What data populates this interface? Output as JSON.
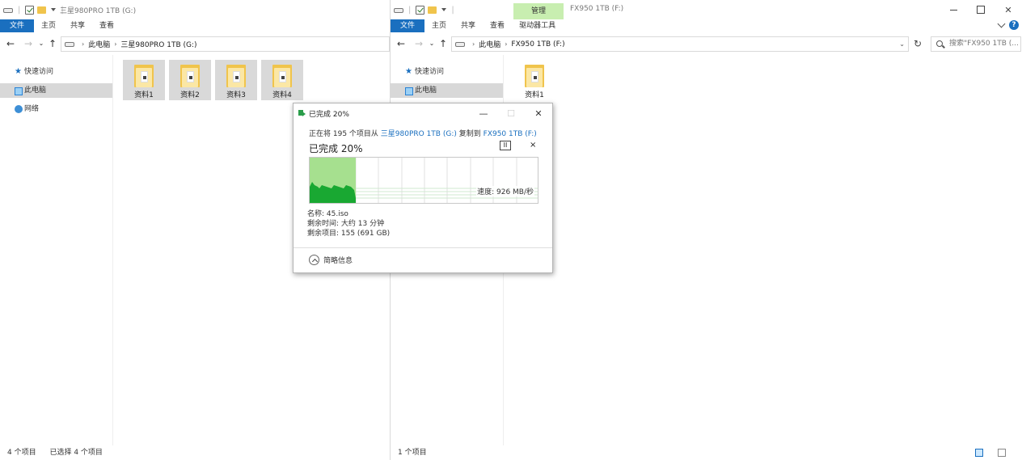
{
  "left_window": {
    "title": "三星980PRO 1TB (G:)",
    "ribbon_tabs": [
      "文件",
      "主页",
      "共享",
      "查看"
    ],
    "address": {
      "segments": [
        "此电脑",
        "三星980PRO 1TB (G:)"
      ]
    },
    "nav": [
      "快速访问",
      "此电脑",
      "网络"
    ],
    "folders": [
      "资料1",
      "资料2",
      "资料3",
      "资料4"
    ],
    "status": {
      "count": "4 个项目",
      "selected": "已选择 4 个项目"
    }
  },
  "right_window": {
    "title": "FX950 1TB (F:)",
    "manage_tab": "管理",
    "ribbon_tabs": [
      "文件",
      "主页",
      "共享",
      "查看",
      "驱动器工具"
    ],
    "address": {
      "segments": [
        "此电脑",
        "FX950 1TB (F:)"
      ]
    },
    "search_placeholder": "搜索\"FX950 1TB (...",
    "nav": [
      "快速访问",
      "此电脑"
    ],
    "folders": [
      "资料1"
    ],
    "status": {
      "count": "1 个项目"
    }
  },
  "copy_dialog": {
    "title": "已完成 20%",
    "line_prefix": "正在将 195 个项目从",
    "source": "三星980PRO 1TB (G:)",
    "line_mid": "复制到",
    "dest": "FX950 1TB (F:)",
    "percent_text": "已完成 20%",
    "progress_fraction": 0.2,
    "speed": "速度: 926 MB/秒",
    "name_label": "名称: 45.iso",
    "time_left": "剩余时间: 大约 13 分钟",
    "items_left": "剩余项目: 155 (691 GB)",
    "less_info": "简略信息",
    "pause_symbol": "II",
    "cancel_symbol": "×"
  },
  "colors": {
    "file_tab": "#1a6fbf",
    "manage_tab": "#c8eeb0",
    "progress_fill": "#a6e08f",
    "speed_fill": "#19a832",
    "link": "#1a6fbf"
  }
}
